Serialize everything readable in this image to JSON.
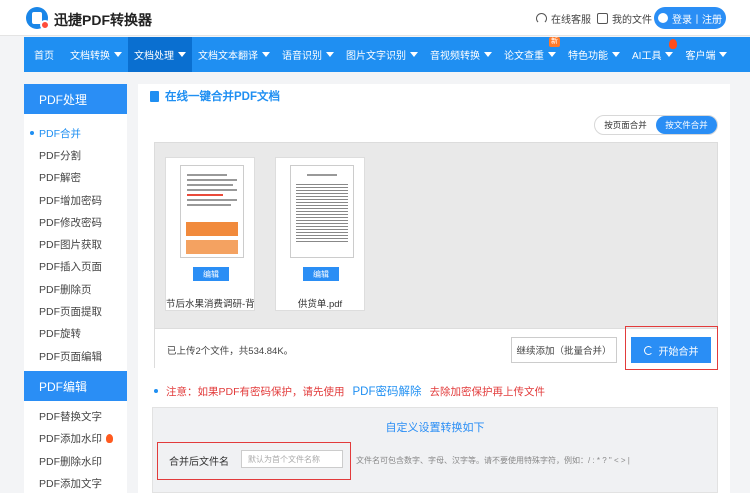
{
  "header": {
    "app_title": "迅捷PDF转换器",
    "online_service": "在线客服",
    "my_files": "我的文件",
    "login": "登录丨注册"
  },
  "nav": {
    "items": [
      {
        "label": "首页",
        "caret": false
      },
      {
        "label": "文档转换",
        "caret": true
      },
      {
        "label": "文档处理",
        "caret": true,
        "active": true
      },
      {
        "label": "文档文本翻译",
        "caret": true
      },
      {
        "label": "语音识别",
        "caret": true
      },
      {
        "label": "图片文字识别",
        "caret": true
      },
      {
        "label": "音视频转换",
        "caret": true
      },
      {
        "label": "论文查重",
        "caret": true,
        "badge": "新"
      },
      {
        "label": "特色功能",
        "caret": true
      },
      {
        "label": "AI工具",
        "caret": true,
        "hot": true
      },
      {
        "label": "客户端",
        "caret": true
      }
    ]
  },
  "sidebar": {
    "section1_title": "PDF处理",
    "section1_items": [
      "PDF合并",
      "PDF分割",
      "PDF解密",
      "PDF增加密码",
      "PDF修改密码",
      "PDF图片获取",
      "PDF插入页面",
      "PDF删除页",
      "PDF页面提取",
      "PDF旋转",
      "PDF页面编辑"
    ],
    "section2_title": "PDF编辑",
    "section2_items": [
      "PDF替换文字",
      "PDF添加水印",
      "PDF删除水印",
      "PDF添加文字"
    ]
  },
  "main": {
    "title": "在线一键合并PDF文档",
    "toggle": {
      "by_page": "按页面合并",
      "by_file": "按文件合并"
    },
    "files": [
      {
        "name": "节后水果消费调研-背景...",
        "edit": "编辑"
      },
      {
        "name": "供货单.pdf",
        "edit": "编辑"
      }
    ],
    "upload_info": "已上传2个文件，共534.84K。",
    "add_button": "继续添加（批量合并）",
    "start_button": "开始合并",
    "notice_prefix": "注意：如果PDF有密码保护，请先使用",
    "notice_link": "PDF密码解除",
    "notice_suffix": "去除加密保护再上传文件",
    "settings_title": "自定义设置转换如下",
    "field_label": "合并后文件名",
    "field_placeholder": "默认为首个文件名称",
    "field_hint": "文件名可包含数字、字母、汉字等。请不要使用特殊字符，例如：/ : * ? \" < > |"
  }
}
